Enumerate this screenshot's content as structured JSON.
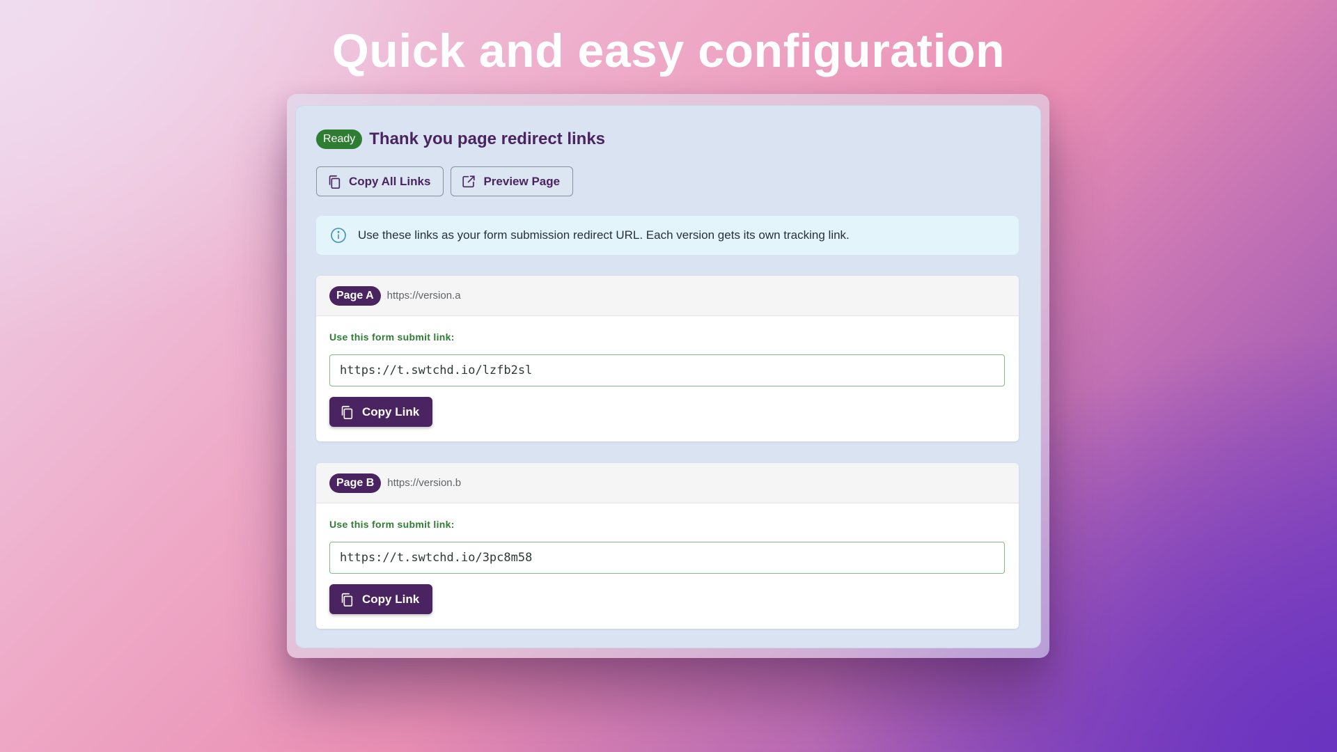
{
  "headline": "Quick and easy configuration",
  "panel": {
    "status_badge": "Ready",
    "title": "Thank you page redirect links",
    "actions": {
      "copy_all_label": "Copy All Links",
      "preview_label": "Preview Page"
    },
    "info_text": "Use these links as your form submission redirect URL. Each version gets its own tracking link."
  },
  "pages": [
    {
      "badge": "Page A",
      "url": "https://version.a",
      "submit_label": "Use this form submit link:",
      "link_value": "https://t.swtchd.io/lzfb2sl",
      "copy_label": "Copy Link"
    },
    {
      "badge": "Page B",
      "url": "https://version.b",
      "submit_label": "Use this form submit link:",
      "link_value": "https://t.swtchd.io/3pc8m58",
      "copy_label": "Copy Link"
    }
  ],
  "colors": {
    "brand": "#4a2361",
    "ready": "#2e7d32",
    "info_bg": "#e4f4fb",
    "link_border": "#7cbf80"
  },
  "icons": {
    "copy": "copy-icon",
    "external": "external-link-icon",
    "info": "info-icon"
  }
}
